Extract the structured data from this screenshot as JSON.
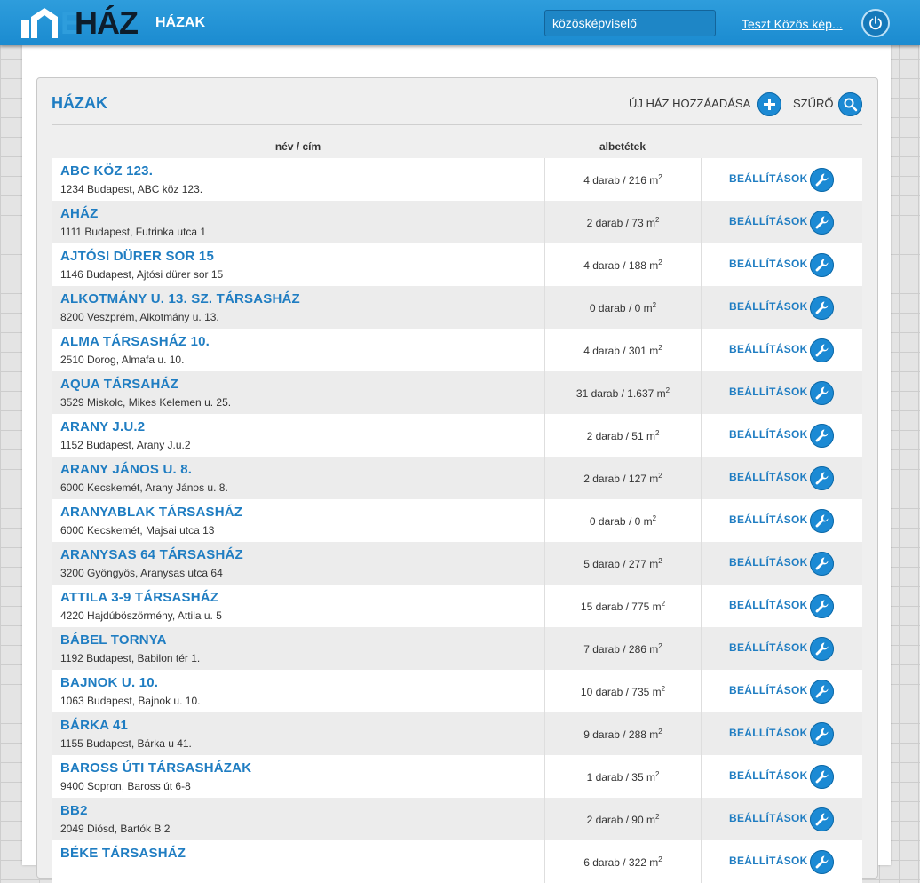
{
  "header": {
    "logo_e": "E",
    "logo_text": "HÁZ",
    "nav_title": "HÁZAK",
    "search_value": "közösképviselő",
    "user_link": "Teszt Közös kép..."
  },
  "panel": {
    "title": "HÁZAK",
    "add_label": "ÚJ HÁZ HOZZÁADÁSA",
    "filter_label": "SZŰRŐ",
    "columns": {
      "name": "név / cím",
      "units": "albetétek"
    },
    "settings_label": "BEÁLLÍTÁSOK",
    "rows": [
      {
        "name": "ABC köz 123.",
        "address": "1234 Budapest, ABC köz 123.",
        "units": "4 darab / 216 m",
        "exp": "2"
      },
      {
        "name": "AHÁZ",
        "address": "1111 Budapest, Futrinka utca 1",
        "units": "2 darab / 73 m",
        "exp": "2"
      },
      {
        "name": "Ajtósi Dürer sor 15",
        "address": "1146 Budapest, Ajtósi dürer sor 15",
        "units": "4 darab / 188 m",
        "exp": "2"
      },
      {
        "name": "Alkotmány u. 13. sz. Társasház",
        "address": "8200 Veszprém, Alkotmány u. 13.",
        "units": "0 darab / 0 m",
        "exp": "2"
      },
      {
        "name": "Alma Társasház 10.",
        "address": "2510 Dorog, Almafa u. 10.",
        "units": "4 darab / 301 m",
        "exp": "2"
      },
      {
        "name": "AQUA Társaház",
        "address": "3529 Miskolc, Mikes Kelemen u. 25.",
        "units": "31 darab / 1.637 m",
        "exp": "2"
      },
      {
        "name": "Arany J.u.2",
        "address": "1152 Budapest, Arany J.u.2",
        "units": "2 darab / 51 m",
        "exp": "2"
      },
      {
        "name": "Arany János u. 8.",
        "address": "6000 Kecskemét, Arany János u. 8.",
        "units": "2 darab / 127 m",
        "exp": "2"
      },
      {
        "name": "Aranyablak Társasház",
        "address": "6000 Kecskemét, Majsai utca 13",
        "units": "0 darab / 0 m",
        "exp": "2"
      },
      {
        "name": "Aranysas 64 Társasház",
        "address": "3200 Gyöngyös, Aranysas utca 64",
        "units": "5 darab / 277 m",
        "exp": "2"
      },
      {
        "name": "Attila 3-9 Társasház",
        "address": "4220 Hajdúböszörmény, Attila u. 5",
        "units": "15 darab / 775 m",
        "exp": "2"
      },
      {
        "name": "Bábel Tornya",
        "address": "1192 Budapest, Babilon tér 1.",
        "units": "7 darab / 286 m",
        "exp": "2"
      },
      {
        "name": "Bajnok u. 10.",
        "address": "1063 Budapest, Bajnok u. 10.",
        "units": "10 darab / 735 m",
        "exp": "2"
      },
      {
        "name": "Bárka 41",
        "address": "1155 Budapest, Bárka u 41.",
        "units": "9 darab / 288 m",
        "exp": "2"
      },
      {
        "name": "Baross úti társasházak",
        "address": "9400 Sopron, Baross út 6-8",
        "units": "1 darab / 35 m",
        "exp": "2"
      },
      {
        "name": "BB2",
        "address": "2049 Diósd, Bartók B 2",
        "units": "2 darab / 90 m",
        "exp": "2"
      },
      {
        "name": "Béke Társasház",
        "address": "",
        "units": "6 darab / 322 m",
        "exp": "2"
      }
    ]
  },
  "colors": {
    "topbar": "#1f90d4",
    "accent": "#1f7dc2",
    "button": "#1c8ad4"
  }
}
